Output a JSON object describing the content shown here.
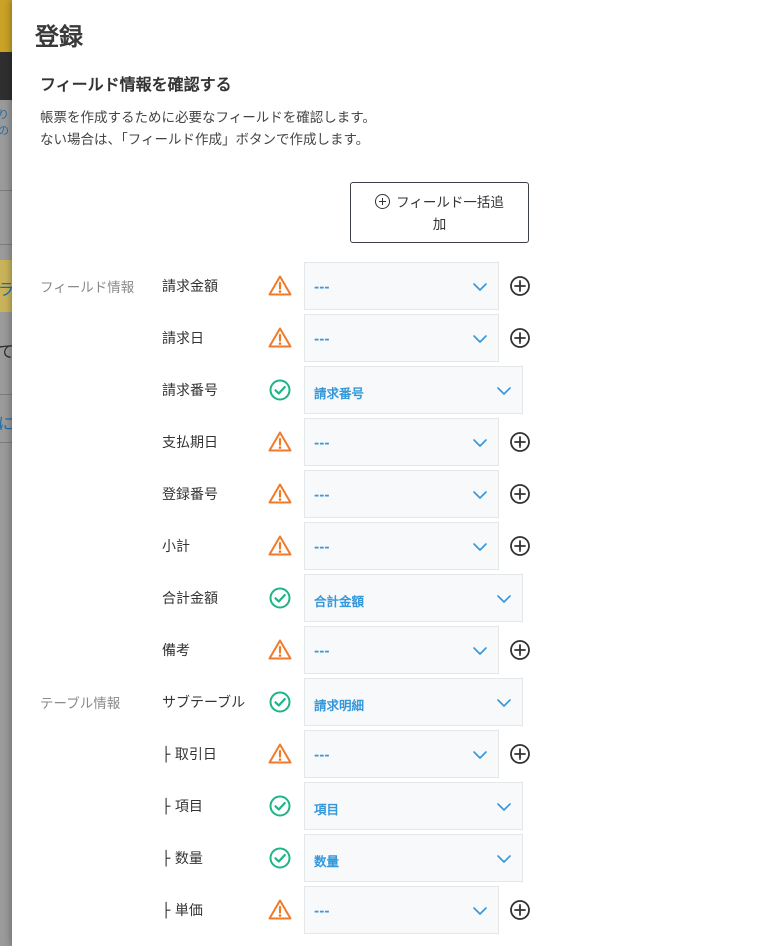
{
  "dialog": {
    "title": "登録",
    "subtitle": "フィールド情報を確認する",
    "description_line1": "帳票を作成するために必要なフィールドを確認します。",
    "description_line2": "ない場合は、「フィールド作成」ボタンで作成します。",
    "bulk_add_line1": "フィールド一括追",
    "bulk_add_line2": "加"
  },
  "background_fragments": [
    "りの",
    "ラ",
    "て",
    "に"
  ],
  "sections": {
    "field_info": "フィールド情報",
    "table_info": "テーブル情報"
  },
  "rows": [
    {
      "name": "請求金額",
      "status": "warning",
      "value": "---",
      "add": true
    },
    {
      "name": "請求日",
      "status": "warning",
      "value": "---",
      "add": true
    },
    {
      "name": "請求番号",
      "status": "ok",
      "value": "請求番号",
      "add": false
    },
    {
      "name": "支払期日",
      "status": "warning",
      "value": "---",
      "add": true
    },
    {
      "name": "登録番号",
      "status": "warning",
      "value": "---",
      "add": true
    },
    {
      "name": "小計",
      "status": "warning",
      "value": "---",
      "add": true
    },
    {
      "name": "合計金額",
      "status": "ok",
      "value": "合計金額",
      "add": false
    },
    {
      "name": "備考",
      "status": "warning",
      "value": "---",
      "add": true
    },
    {
      "name": "サブテーブル",
      "status": "ok",
      "value": "請求明細",
      "add": false
    },
    {
      "name": "├ 取引日",
      "status": "warning",
      "value": "---",
      "add": true
    },
    {
      "name": "├ 項目",
      "status": "ok",
      "value": "項目",
      "add": false
    },
    {
      "name": "├ 数量",
      "status": "ok",
      "value": "数量",
      "add": false
    },
    {
      "name": "├ 単価",
      "status": "warning",
      "value": "---",
      "add": true
    }
  ],
  "colors": {
    "warning": "#f07a2c",
    "ok": "#1fb489",
    "select_text": "#3498db",
    "chevron": "#3498db",
    "add_icon": "#333333"
  }
}
